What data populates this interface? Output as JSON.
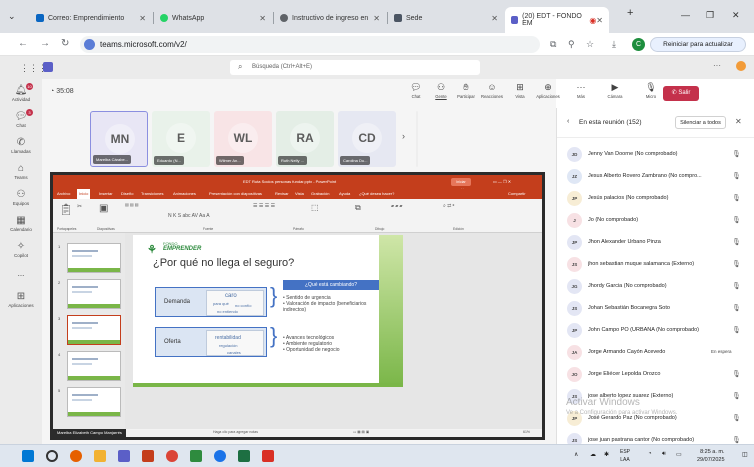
{
  "browser": {
    "tabs": [
      {
        "label": "Correo: Emprendimiento",
        "color": "#0a66c2"
      },
      {
        "label": "WhatsApp",
        "color": "#25d366"
      },
      {
        "label": "Instructivo de ingreso en",
        "color": "#5f6368"
      },
      {
        "label": "Sede",
        "color": "#4b5563"
      },
      {
        "label": "(20) EDT - FONDO EM",
        "color": "#5b5fc7"
      }
    ],
    "new_tab": "+",
    "url": "teams.microsoft.com/v2/",
    "relaunch_label": "Reiniciar para actualizar",
    "profile_initial": "C"
  },
  "teams": {
    "search_placeholder": "Búsqueda (Ctrl+Alt+E)",
    "rail": [
      {
        "label": "Actividad",
        "icon": "bell-icon",
        "badge": "10"
      },
      {
        "label": "Chat",
        "icon": "chat-icon",
        "badge": "3"
      },
      {
        "label": "Llamadas",
        "icon": "phone-icon"
      },
      {
        "label": "Teams",
        "icon": "teams-icon"
      },
      {
        "label": "Equipos",
        "icon": "people-icon"
      },
      {
        "label": "Calendario",
        "icon": "calendar-icon"
      },
      {
        "label": "Copilot",
        "icon": "copilot-icon"
      },
      {
        "label": "...",
        "icon": "more-icon"
      },
      {
        "label": "Aplicaciones",
        "icon": "apps-icon"
      }
    ],
    "timer": "35:08",
    "toolbar": [
      {
        "label": "Chat",
        "icon": "chat-icon"
      },
      {
        "label": "Gente",
        "icon": "people-icon",
        "badge": "152"
      },
      {
        "label": "Participar",
        "icon": "hand-icon"
      },
      {
        "label": "Reacciones",
        "icon": "emoji-icon"
      },
      {
        "label": "Vista",
        "icon": "view-icon"
      },
      {
        "label": "Aplicaciones",
        "icon": "apps-plus-icon"
      },
      {
        "label": "Más",
        "icon": "more-icon"
      },
      {
        "label": "Cámara",
        "icon": "camera-off-icon"
      },
      {
        "label": "Micro",
        "icon": "mic-off-icon"
      },
      {
        "label": "Compartir",
        "icon": "share-icon"
      }
    ],
    "leave_label": "Salir",
    "gallery": [
      {
        "initials": "MN",
        "name": "Marelba Cárabe...",
        "bg": "#e8e6f5",
        "fg": "#5c5c5c"
      },
      {
        "initials": "E",
        "name": "Eduardo (N...",
        "bg": "#e9f2ea",
        "fg": "#5c5c5c"
      },
      {
        "initials": "WL",
        "name": "Wilmer An...",
        "bg": "#f8e4e6",
        "fg": "#5c5c5c"
      },
      {
        "initials": "RA",
        "name": "Ruth Nelly ...",
        "bg": "#e4eee6",
        "fg": "#5c5c5c"
      },
      {
        "initials": "CD",
        "name": "Carolina Du...",
        "bg": "#e6e8f2",
        "fg": "#5c5c5c"
      },
      {
        "initials": "",
        "name": "",
        "bg": "#eeeeee",
        "fg": "#5c5c5c"
      },
      {
        "initials": "E",
        "name": "",
        "bg": "#f7eedc",
        "fg": "#5c5c5c"
      }
    ]
  },
  "ppt": {
    "title": "EDT Ruta Socios personas fundar.pptx - PowerPoint",
    "signin": "Iniciar sesión",
    "menu": [
      "Archivo",
      "Inicio",
      "Insertar",
      "Diseño",
      "Transiciones",
      "Animaciones",
      "Presentación con diapositivas",
      "Revisar",
      "Vista",
      "Grabación",
      "Ayuda",
      "¿Qué desea hacer?",
      "Compartir"
    ],
    "ribbon_groups": [
      "Portapapeles",
      "Diapositivas",
      "Fuente",
      "Párrafo",
      "Dibujo",
      "Edición"
    ],
    "slides": [
      "1",
      "2",
      "3",
      "4",
      "5"
    ],
    "slide": {
      "logo_top": "FONDO",
      "logo_main": "EMPRENDER",
      "title": "¿Por qué no llega el seguro?",
      "row1_label": "Demanda",
      "row2_label": "Oferta",
      "row1_words": [
        "caro",
        "para qué",
        "no confío",
        "no entiendo"
      ],
      "row2_words": [
        "rentabilidad",
        "regulación",
        "canales"
      ],
      "question": "¿Qué está cambiando?",
      "bullets1": [
        "Sentido de urgencia",
        "Valoración de impacto (beneficiarios indirectos)"
      ],
      "bullets2": [
        "Avances tecnológicos",
        "Ambiente regulatorio",
        "Oportunidad de negocio"
      ]
    },
    "notes": "Haga clic para agregar notas",
    "presenter": "Marelba Elizabeth Campo Manjarrés",
    "zoom": "61%"
  },
  "participants": {
    "title": "En esta reunión (152)",
    "mute_all": "Silenciar a todos",
    "list": [
      {
        "initials": "JD",
        "name": "Jenny Van Doorne (No comprobado)",
        "color": "#e3e6f4"
      },
      {
        "initials": "JZ",
        "name": "Jesus Alberto Rovero Zambrano (No compro...",
        "color": "#dfe7f5"
      },
      {
        "initials": "JP",
        "name": "Jesús palacios (No comprobado)",
        "color": "#f7edd5"
      },
      {
        "initials": "J",
        "name": "Jo (No comprobado)",
        "color": "#f7e1e4"
      },
      {
        "initials": "JP",
        "name": "Jhon Alexander Urbano Pinza",
        "color": "#e3e6f4"
      },
      {
        "initials": "JS",
        "name": "jhon sebastian muque salamanca (Externo)",
        "color": "#f7e1e4"
      },
      {
        "initials": "JG",
        "name": "Jhordy Garcia (No comprobado)",
        "color": "#e3e6f4"
      },
      {
        "initials": "JS",
        "name": "Johan Sebastián Bocanegra Soto",
        "color": "#e3e6f4"
      },
      {
        "initials": "JP",
        "name": "John Campo PO (URBANA (No comprobado)",
        "color": "#e3e6f4"
      },
      {
        "initials": "JA",
        "name": "Jorge Armando Cayón Acevedo",
        "color": "#f7e1e4",
        "role": "En espera"
      },
      {
        "initials": "JO",
        "name": "Jorge Eliécer Lepolda Orozco",
        "color": "#f7e1e4"
      },
      {
        "initials": "JS",
        "name": "jose alberto lopez suarez (Externo)",
        "color": "#e3e6f4"
      },
      {
        "initials": "JP",
        "name": "José Gerardo Paz (No comprobado)",
        "color": "#f7edd5"
      },
      {
        "initials": "JS",
        "name": "jose juan pastrana cantor (No comprobado)",
        "color": "#e3e6f4"
      }
    ],
    "watermark": "Activar Windows",
    "watermark_sub": "Ve a Configuración para activar Windows."
  },
  "taskbar": {
    "lang": [
      "ESP",
      "LAA"
    ],
    "time": "8:25 a. m.",
    "date": "29/07/2025",
    "apps": [
      {
        "name": "windows-start-icon",
        "color": "#0078d4"
      },
      {
        "name": "search-icon",
        "color": "#333333"
      },
      {
        "name": "firefox-icon",
        "color": "#e66000"
      },
      {
        "name": "files-icon",
        "color": "#f2b233"
      },
      {
        "name": "teams-icon",
        "color": "#5b5fc7"
      },
      {
        "name": "app-red-icon",
        "color": "#c43e1c"
      },
      {
        "name": "chrome-icon",
        "color": "#db4437"
      },
      {
        "name": "app-green-icon",
        "color": "#2e8b3e"
      },
      {
        "name": "chrome-2-icon",
        "color": "#1a73e8"
      },
      {
        "name": "excel-icon",
        "color": "#1d6f42"
      },
      {
        "name": "pdf-icon",
        "color": "#d93025"
      }
    ]
  }
}
